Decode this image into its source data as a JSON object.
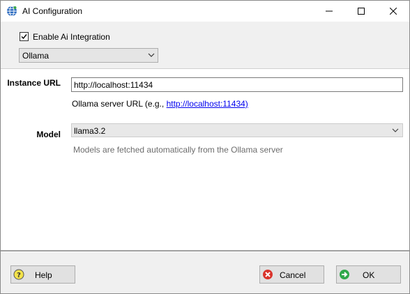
{
  "window": {
    "title": "AI Configuration",
    "icon": "globe-network-icon"
  },
  "integration": {
    "enable_label": "Enable Ai Integration",
    "enabled": true,
    "provider_selected": "Ollama"
  },
  "instance": {
    "label": "Instance URL",
    "value": "http://localhost:11434",
    "help_prefix": "Ollama server URL (e.g., ",
    "help_link": "http://localhost:11434)"
  },
  "model": {
    "label": "Model",
    "selected": "llama3.2",
    "hint": "Models are fetched automatically from the Ollama server"
  },
  "buttons": {
    "help": "Help",
    "cancel": "Cancel",
    "ok": "OK"
  },
  "colors": {
    "link": "#0000ee",
    "hint": "#6d6d6d",
    "dialog_bg": "#f0f0f0"
  }
}
